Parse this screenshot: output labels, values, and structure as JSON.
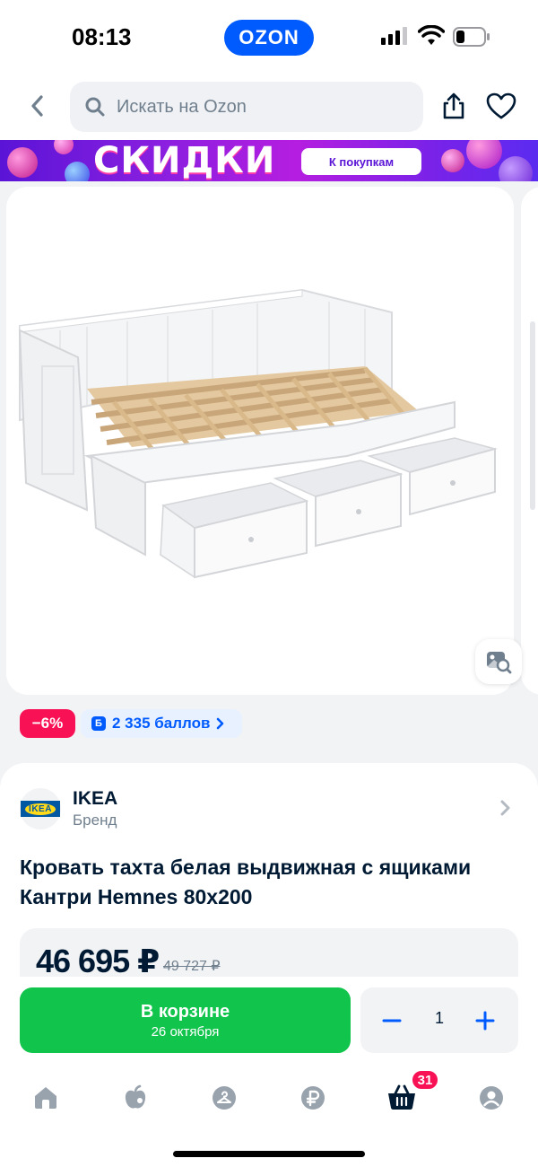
{
  "status_bar": {
    "time": "08:13",
    "app_pill": "OZON"
  },
  "header": {
    "back_icon": "chevron-left-icon",
    "search_placeholder": "Искать на Ozon",
    "share_icon": "share-icon",
    "favorite_icon": "heart-icon"
  },
  "banner": {
    "title": "СКИДКИ",
    "button_label": "К покупкам"
  },
  "gallery": {
    "product_image": "daybed-with-drawers-image",
    "visual_search_icon": "image-search-icon"
  },
  "badges": {
    "discount": "−6%",
    "points_icon_letter": "Б",
    "points": "2 335 баллов"
  },
  "brand": {
    "name": "IKEA",
    "label": "Бренд",
    "logo_text": "IKEA"
  },
  "product": {
    "title": "Кровать тахта белая выдвижная с ящиками Кантри Hemnes 80x200"
  },
  "price": {
    "current": "46 695 ₽",
    "old": "49 727 ₽"
  },
  "cart": {
    "button_label": "В корзине",
    "delivery_date": "26 октября",
    "quantity": "1"
  },
  "bottom_nav": {
    "items": [
      "home-icon",
      "fresh-icon",
      "hanger-icon",
      "ruble-icon",
      "cart-icon",
      "profile-icon"
    ],
    "cart_badge": "31"
  },
  "colors": {
    "brand_blue": "#005bff",
    "cta_green": "#10c44c",
    "discount_red": "#f91155"
  }
}
